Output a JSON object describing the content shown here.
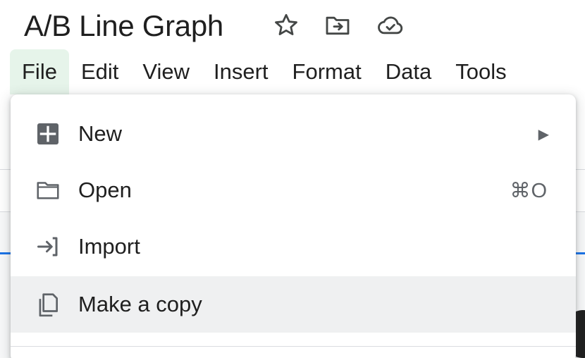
{
  "document": {
    "title": "A/B Line Graph"
  },
  "title_icons": [
    {
      "name": "star-icon"
    },
    {
      "name": "move-folder-icon"
    },
    {
      "name": "cloud-saved-icon"
    }
  ],
  "menubar": {
    "items": [
      {
        "label": "File",
        "active": true
      },
      {
        "label": "Edit"
      },
      {
        "label": "View"
      },
      {
        "label": "Insert"
      },
      {
        "label": "Format"
      },
      {
        "label": "Data"
      },
      {
        "label": "Tools"
      }
    ]
  },
  "file_menu": {
    "items": [
      {
        "label": "New",
        "icon": "new-sheet-icon",
        "submenu_arrow": "▶"
      },
      {
        "label": "Open",
        "icon": "folder-icon",
        "shortcut": "⌘O"
      },
      {
        "label": "Import",
        "icon": "import-icon"
      },
      {
        "label": "Make a copy",
        "icon": "copy-icon",
        "highlighted": true
      }
    ]
  },
  "colors": {
    "active_menu_bg": "#e6f4ea",
    "hover_row_bg": "#eff0f1",
    "icon_gray": "#5f6368",
    "accent_blue": "#1a73e8"
  }
}
